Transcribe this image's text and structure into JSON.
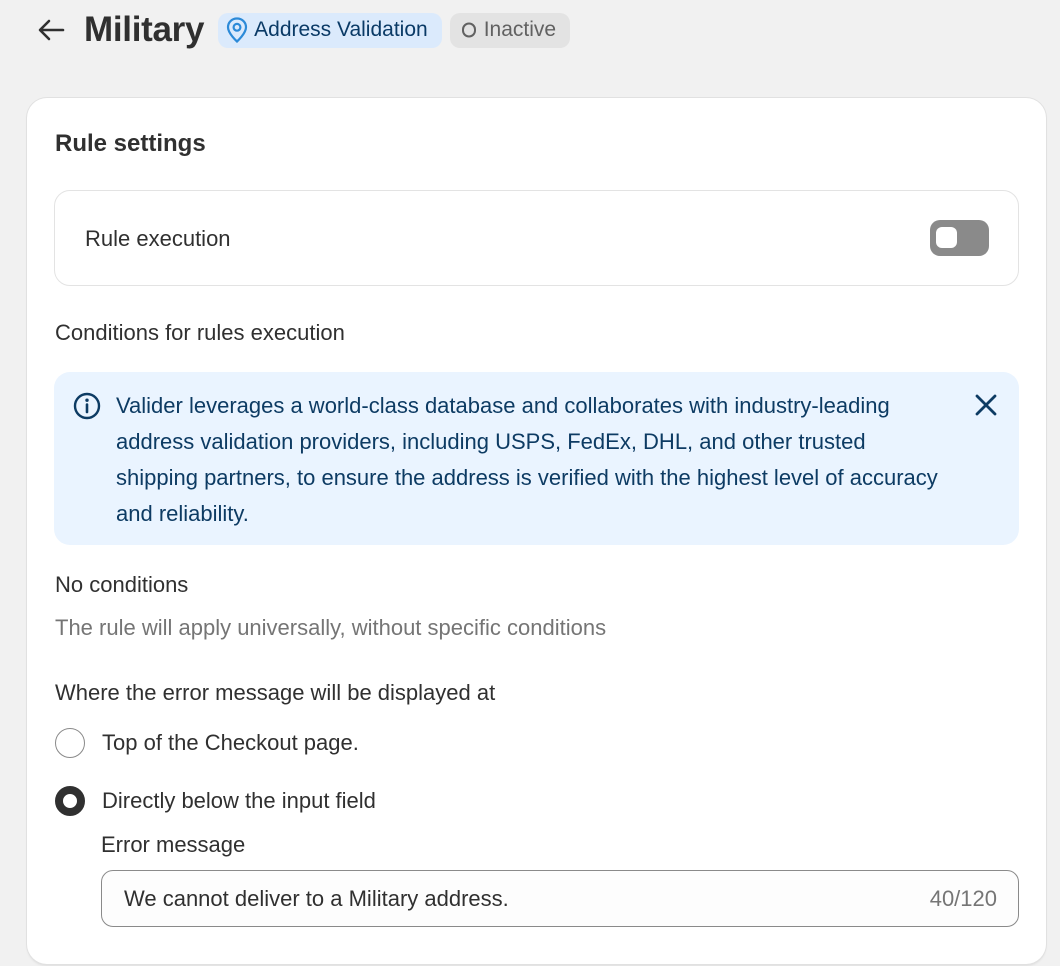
{
  "header": {
    "title": "Military",
    "type_badge": "Address Validation",
    "status_badge": "Inactive",
    "icons": {
      "back": "arrow-left-icon",
      "type": "location-pin-icon",
      "status": "status-circle-icon"
    }
  },
  "card": {
    "title": "Rule settings",
    "rule_execution": {
      "label": "Rule execution",
      "enabled": false
    },
    "conditions_label": "Conditions for rules execution",
    "info_banner": {
      "text": "Valider leverages a world-class database and collaborates with industry-leading address validation providers, including USPS, FedEx, DHL, and other trusted shipping partners, to ensure the address is verified with the highest level of accuracy and reliability.",
      "icon": "info-icon",
      "dismiss_icon": "close-icon"
    },
    "no_conditions": {
      "title": "No conditions",
      "description": "The rule will apply universally, without specific conditions"
    },
    "display_location": {
      "label": "Where the error message will be displayed at",
      "options": [
        {
          "label": "Top of the Checkout page.",
          "selected": false
        },
        {
          "label": "Directly below the input field",
          "selected": true
        }
      ]
    },
    "error_message": {
      "label": "Error message",
      "value": "We cannot deliver to a Military address.",
      "count": "40/120"
    }
  },
  "colors": {
    "page_bg": "#f1f1f1",
    "card_bg": "#ffffff",
    "type_badge_bg": "#dbeafc",
    "status_badge_bg": "#e3e3e3",
    "info_bg": "#eaf4ff",
    "toggle_off": "#8a8a8a",
    "text_primary": "#303030",
    "text_secondary": "#757575"
  }
}
